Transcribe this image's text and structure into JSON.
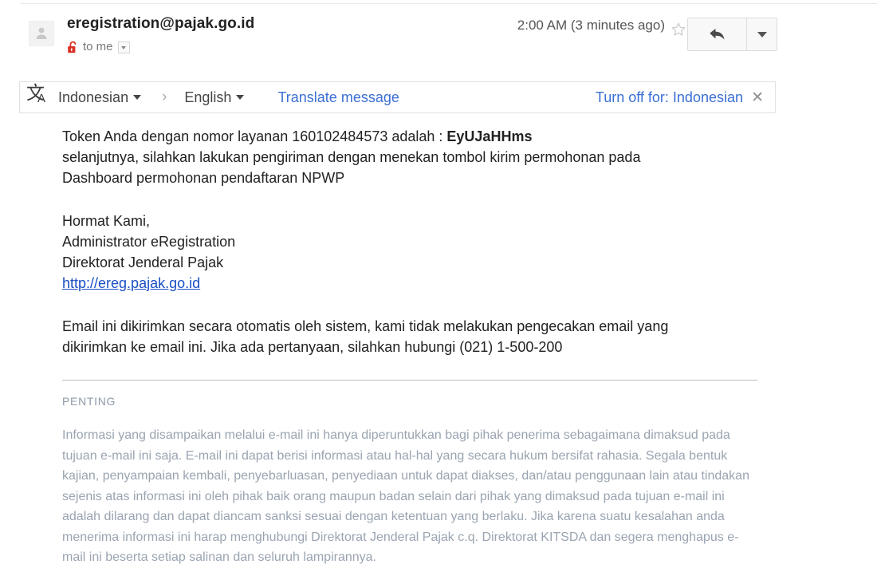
{
  "header": {
    "avatar_icon": "person-avatar-icon",
    "sender": "eregistration@pajak.go.id",
    "lock_icon": "unlocked-padlock-icon",
    "recipient": "to me",
    "details_caret_icon": "chevron-down-icon",
    "timestamp": "2:00 AM (3 minutes ago)",
    "star_icon": "star-outline-icon",
    "reply_icon": "reply-arrow-icon",
    "more_icon": "chevron-down-icon"
  },
  "translate_bar": {
    "icon": "translate-icon",
    "icon_cjk": "文",
    "icon_latin": "A",
    "source_language": "Indonesian",
    "arrow": "›",
    "target_language": "English",
    "translate_label": "Translate message",
    "turn_off_label": "Turn off for: Indonesian",
    "close_icon": "close-x-icon"
  },
  "body": {
    "intro_line1_prefix": "Token Anda dengan nomor layanan 160102484573 adalah : ",
    "token": "EyUJaHHms",
    "intro_line2": "selanjutnya, silahkan lakukan pengiriman dengan menekan tombol kirim permohonan pada",
    "intro_line3": "Dashboard permohonan pendaftaran NPWP",
    "signature": {
      "line1": "Hormat Kami,",
      "line2": "Administrator eRegistration",
      "line3": "Direktorat Jenderal Pajak",
      "link": "http://ereg.pajak.go.id"
    },
    "auto_note_line1": "Email ini dikirimkan secara otomatis oleh sistem, kami tidak melakukan pengecakan email yang",
    "auto_note_line2": "dikirimkan ke email ini. Jika ada pertanyaan, silahkan hubungi (021) 1-500-200",
    "disclaimer_heading": "PENTING",
    "disclaimer_text": "Informasi yang disampaikan melalui e-mail ini hanya diperuntukkan bagi pihak penerima sebagaimana dimaksud pada tujuan e-mail ini saja. E-mail ini dapat berisi informasi atau hal-hal yang secara hukum bersifat rahasia. Segala bentuk kajian, penyampaian kembali, penyebarluasan, penyediaan untuk dapat diakses, dan/atau penggunaan lain atau tindakan sejenis atas informasi ini oleh pihak baik orang maupun badan selain dari pihak yang dimaksud pada tujuan e-mail ini adalah dilarang dan dapat diancam sanksi sesuai dengan ketentuan yang berlaku. Jika karena suatu kesalahan anda menerima informasi ini harap menghubungi Direktorat Jenderal Pajak c.q. Direktorat KITSDA dan segera menghapus e-mail ini beserta setiap salinan dan seluruh lampirannya."
  },
  "colors": {
    "link_blue": "#3b6fd4",
    "url_blue": "#1a4fc4",
    "lock_red": "#d93025",
    "disclaimer_gray": "#9aa4b1",
    "border_gray": "#e0e0e0"
  }
}
